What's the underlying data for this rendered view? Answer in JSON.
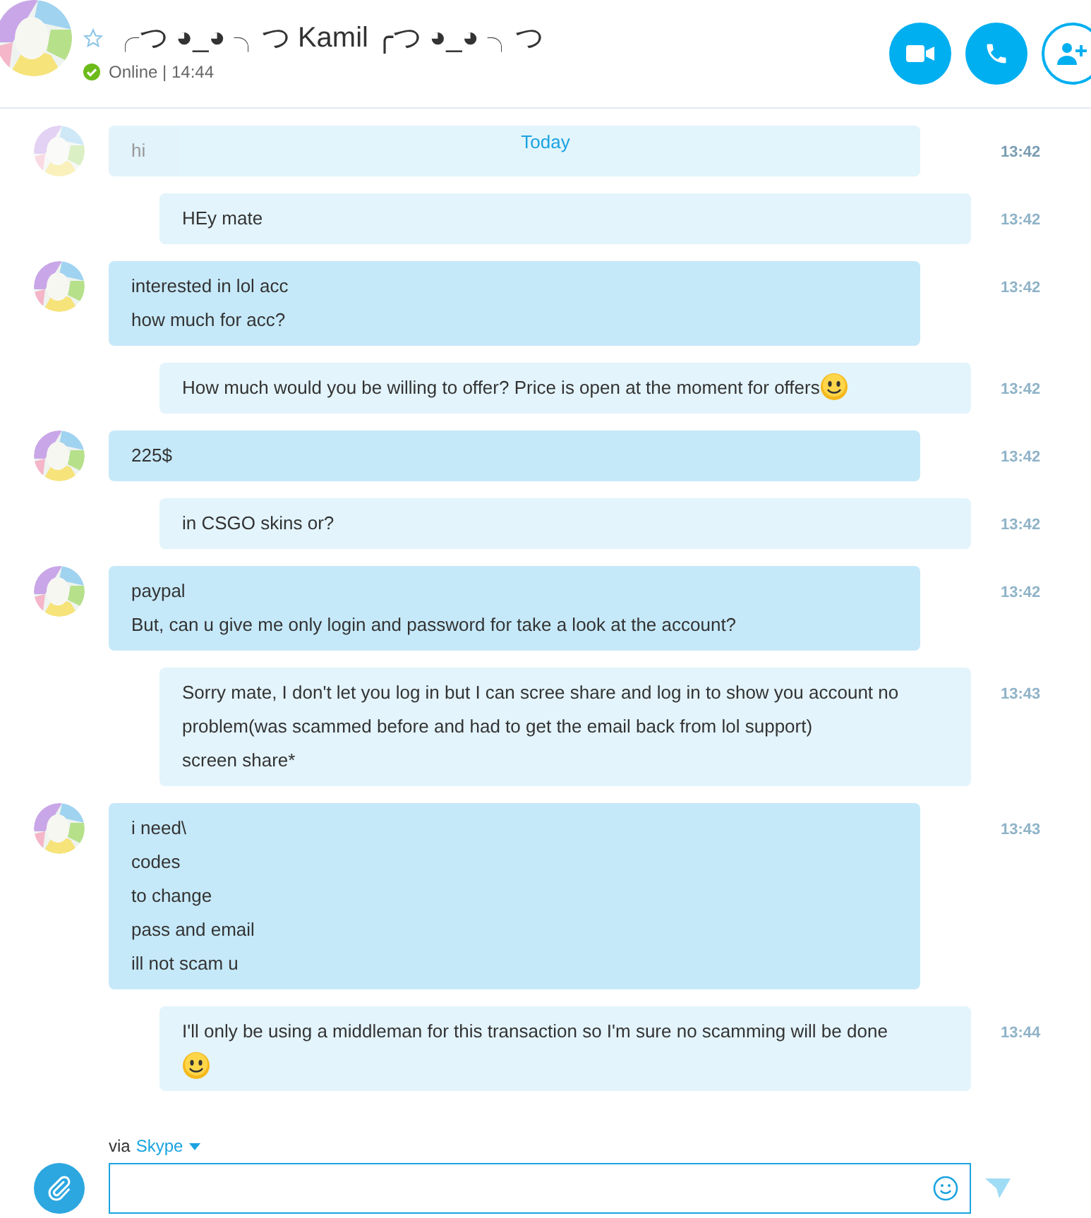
{
  "contact": {
    "name": "╭つ ◕_◕ ╮つ Kamil ╭つ ◕_◕ ╮つ",
    "favorite": false,
    "status": "Online",
    "separator": "|",
    "time": "14:44"
  },
  "date_divider": "Today",
  "messages": [
    {
      "kind": "them",
      "faded": true,
      "lines": [
        "hi"
      ],
      "time": "13:42"
    },
    {
      "kind": "me",
      "faded": false,
      "lines": [
        "HEy mate"
      ],
      "time": "13:42"
    },
    {
      "kind": "them",
      "faded": false,
      "lines": [
        "interested in lol acc",
        "how much for acc?"
      ],
      "time": "13:42"
    },
    {
      "kind": "me",
      "faded": false,
      "lines": [
        "How much would you be willing to offer? Price is open at the moment for offers"
      ],
      "emoji": true,
      "emoji_own_line": false,
      "time": "13:42"
    },
    {
      "kind": "them",
      "faded": false,
      "lines": [
        "225$"
      ],
      "time": "13:42"
    },
    {
      "kind": "me",
      "faded": false,
      "lines": [
        "in CSGO skins or?"
      ],
      "time": "13:42"
    },
    {
      "kind": "them",
      "faded": false,
      "lines": [
        "paypal",
        "But, can u give me only login and password for take a look at the account?"
      ],
      "time": "13:42"
    },
    {
      "kind": "me",
      "faded": false,
      "lines": [
        "Sorry mate, I don't let you log in but I can scree share and log in to show you account no problem(was scammed before and had to get the email back from lol support)",
        "screen share*"
      ],
      "time": "13:43"
    },
    {
      "kind": "them",
      "faded": false,
      "lines": [
        "i need\\",
        "codes",
        "to change",
        "pass and email",
        "ill not scam u"
      ],
      "time": "13:43"
    },
    {
      "kind": "me",
      "faded": false,
      "lines": [
        "I'll only be using  a middleman for this transaction so I'm sure no scamming will be done"
      ],
      "emoji": true,
      "emoji_own_line": true,
      "time": "13:44"
    }
  ],
  "composer": {
    "via_label": "via",
    "service": "Skype"
  }
}
